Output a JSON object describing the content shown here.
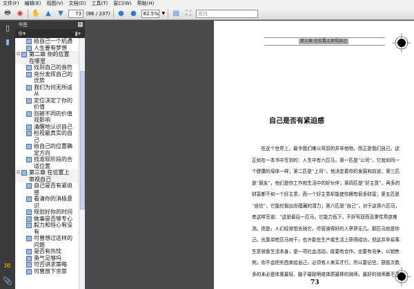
{
  "menu": [
    "文件(F)",
    "编辑(E)",
    "视图(V)",
    "文档(D)",
    "工具(T)",
    "窗口(W)",
    "帮助(H)"
  ],
  "toolbar": {
    "page_input": "73",
    "page_count": "(86 / 237)",
    "zoom": "82.5%",
    "search_placeholder": "查找"
  },
  "panel": {
    "title": "书签"
  },
  "bookmarks": [
    {
      "label": "给自己一个机遇",
      "level": 2
    },
    {
      "label": "人生要有梦想",
      "level": 2
    },
    {
      "label": "第二章  你的位置在哪里",
      "level": 1
    },
    {
      "label": "找到自己的音符",
      "level": 2
    },
    {
      "label": "充分发挥自己的优势",
      "level": 2
    },
    {
      "label": "我们为何无所适从",
      "level": 2
    },
    {
      "label": "定位决定了你的价值",
      "level": 2
    },
    {
      "label": "别被不同的价值观影响",
      "level": 2
    },
    {
      "label": "清醒地认识自己",
      "level": 2
    },
    {
      "label": "检视最真实的自己",
      "level": 2
    },
    {
      "label": "给自己的位置确定方向",
      "level": 2
    },
    {
      "label": "找准现阶段的合适位置",
      "level": 2
    },
    {
      "label": "第三章  在位置上审视自己",
      "level": 1
    },
    {
      "label": "自己是否有紧迫感",
      "level": 2
    },
    {
      "label": "看清你的消极意识",
      "level": 2
    },
    {
      "label": "规划好你的时间",
      "level": 2
    },
    {
      "label": "做事是否够专心",
      "level": 2
    },
    {
      "label": "毅力和恒心有没有",
      "level": 2
    },
    {
      "label": "可曾想过这样的问题",
      "level": 2
    },
    {
      "label": "是否有热忱",
      "level": 2
    },
    {
      "label": "勇气足够吗",
      "level": 2
    },
    {
      "label": "可否讲求策略",
      "level": 2
    },
    {
      "label": "可曾放下余禁",
      "level": 2
    }
  ],
  "document": {
    "running_head": "第三章  在位置上审视自己",
    "title": "自己是否有紧迫感",
    "lines": [
      "　　在这个世界上，最令我们难以驾驭的并非他物，而正是我们自己。这",
      "正如在一本书中写到的：人生中有六匹马，第一匹是“公司”，它就如同一",
      "个健康的母体一样；第二匹是“上司”，他决定着你的发展和前途；第三匹",
      "是“朋友”，他们是你工作和生活中的好伙伴；第四匹是“好主意”，再多的",
      "财富都不如一个好主意，而一个好主意却能使你拥有很多财富；第五匹是",
      "“自信”，它能挖掘出你蕴藏的潜力；第六匹是“自己”，对于这第六匹马，作",
      "者这样写道：“这是最后一匹马，它能力低下，不好驾驭而且秉性乖戾难",
      "测。但是，人们经常想去骑它，尽管骑得好的人寥寥无几。那匹马就是你自",
      "己。光靠单枪匹马地干，也许能在生产或生活上获得成功，但这并非易事。",
      "生意就像生活本身，是一项社会活动，既要有合作，也要有竞争，以销售为",
      "例，你不会把东西卖给自己，必须有人来买才行。所以要记住，获胜次数最",
      "多的未必是体重最轻、脑子最聪明或体质最棒的骑师，最好的骑师赢不了"
    ],
    "page_number": "73"
  }
}
